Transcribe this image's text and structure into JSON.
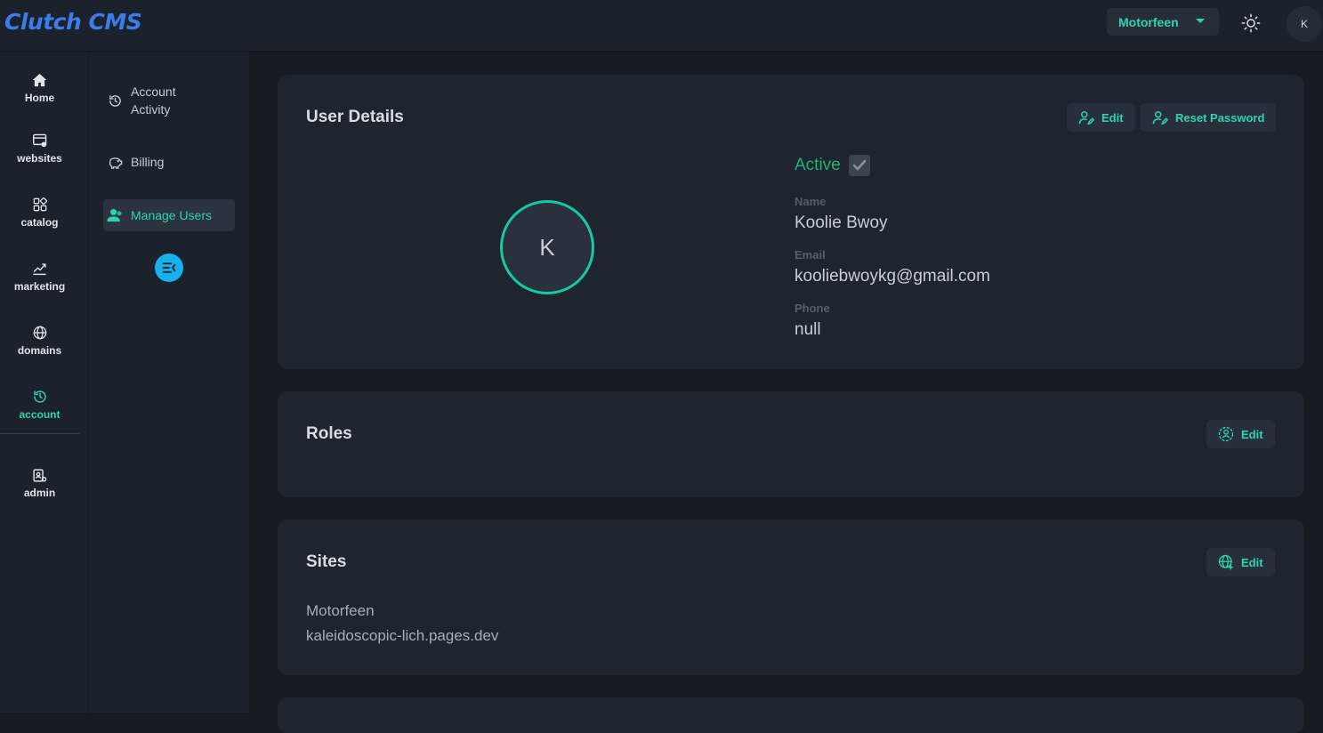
{
  "app": {
    "title": "Clutch CMS"
  },
  "header": {
    "site_select": "Motorfeen",
    "theme_icon": "sun-icon",
    "avatar_initial": "K"
  },
  "rail": {
    "items": [
      {
        "label": "Home",
        "icon": "home-icon"
      },
      {
        "label": "websites",
        "icon": "website-icon"
      },
      {
        "label": "catalog",
        "icon": "catalog-icon"
      },
      {
        "label": "marketing",
        "icon": "marketing-icon"
      },
      {
        "label": "domains",
        "icon": "globe-icon"
      },
      {
        "label": "account",
        "icon": "history-icon",
        "active": true
      },
      {
        "label": "admin",
        "icon": "admin-icon"
      }
    ]
  },
  "subnav": {
    "items": [
      {
        "label": "Account Activity",
        "icon": "history-icon"
      },
      {
        "label": "Billing",
        "icon": "piggy-bank-icon"
      },
      {
        "label": "Manage Users",
        "icon": "users-icon",
        "active": true
      }
    ],
    "collapse_icon": "collapse-menu-icon"
  },
  "user_details": {
    "title": "User Details",
    "edit_label": "Edit",
    "reset_password_label": "Reset Password",
    "avatar_initial": "K",
    "status": "Active",
    "name_label": "Name",
    "name_value": "Koolie Bwoy",
    "email_label": "Email",
    "email_value": "kooliebwoykg@gmail.com",
    "phone_label": "Phone",
    "phone_value": "null"
  },
  "roles": {
    "title": "Roles",
    "edit_label": "Edit"
  },
  "sites": {
    "title": "Sites",
    "edit_label": "Edit",
    "items": [
      "Motorfeen",
      "kaleidoscopic-lich.pages.dev"
    ]
  },
  "colors": {
    "accent": "#2fd3b3",
    "logo": "#3d7be8",
    "active_status": "#21b373",
    "background": "#161b22",
    "card": "#1f252e"
  }
}
